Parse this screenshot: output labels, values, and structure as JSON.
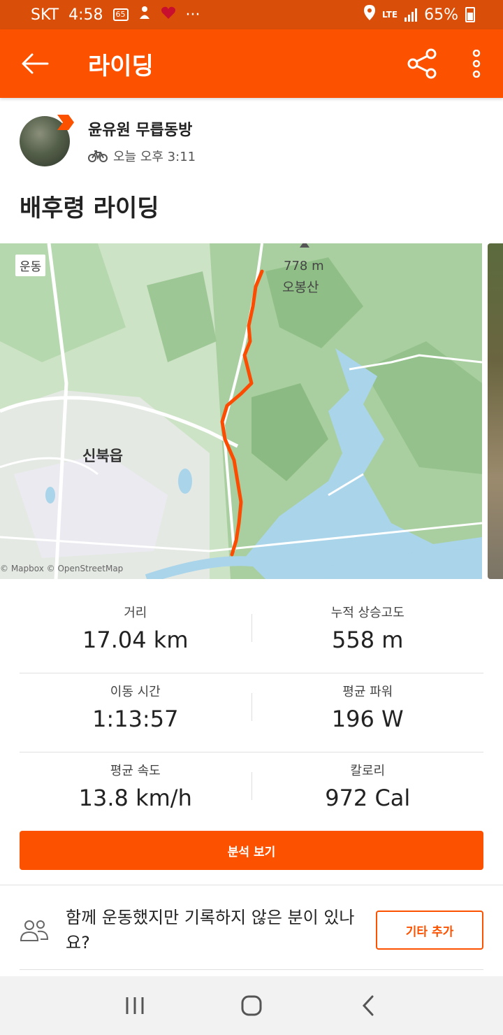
{
  "status_bar": {
    "carrier": "SKT",
    "time": "4:58",
    "notification_badge": "65",
    "more": "···",
    "network": "LTE",
    "battery": "65%"
  },
  "app_bar": {
    "title": "라이딩",
    "icons": [
      "back-arrow-icon",
      "share-icon",
      "more-vertical-icon"
    ]
  },
  "athlete": {
    "name": "윤유원 무릅동방",
    "activity_time": "오늘 오후 3:11"
  },
  "activity": {
    "title": "배후령 라이딩"
  },
  "map": {
    "badge": "운동",
    "peak_elevation": "778 m",
    "peak_name": "오봉산",
    "town": "신북읍",
    "attribution": "© Mapbox © OpenStreetMap",
    "route_color": "#fc4c02"
  },
  "stats": [
    {
      "label": "거리",
      "value": "17.04 km"
    },
    {
      "label": "누적 상승고도",
      "value": "558 m"
    },
    {
      "label": "이동 시간",
      "value": "1:13:57"
    },
    {
      "label": "평균 파워",
      "value": "196 W"
    },
    {
      "label": "평균 속도",
      "value": "13.8 km/h"
    },
    {
      "label": "칼로리",
      "value": "972 Cal"
    }
  ],
  "analysis_button": "분석 보기",
  "group_prompt": {
    "text": "함께 운동했지만 기록하지 않은 분이 있나요?",
    "button": "기타 추가"
  },
  "colors": {
    "brand": "#fc5200",
    "status_bar": "#d94f0a"
  }
}
